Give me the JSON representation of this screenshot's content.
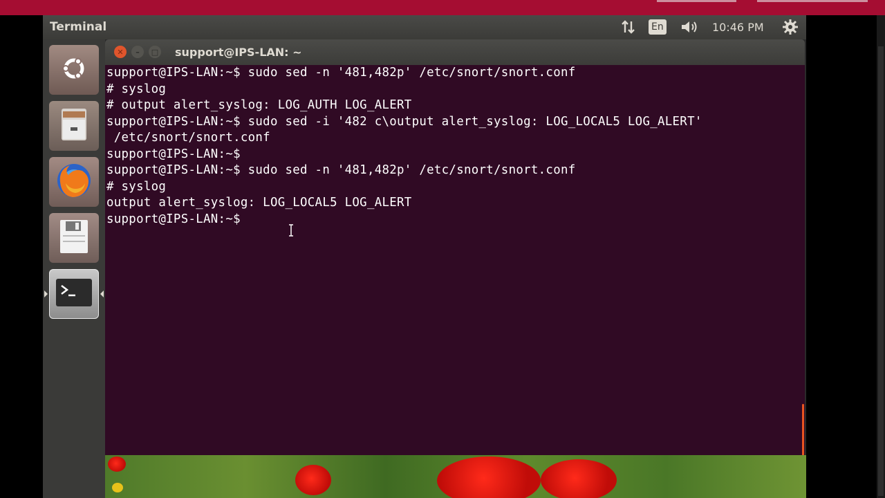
{
  "panel": {
    "app_title": "Terminal",
    "keyboard_layout": "En",
    "clock": "10:46 PM"
  },
  "window": {
    "title": "support@IPS-LAN: ~"
  },
  "terminal": {
    "lines": [
      "support@IPS-LAN:~$ sudo sed -n '481,482p' /etc/snort/snort.conf",
      "# syslog",
      "# output alert_syslog: LOG_AUTH LOG_ALERT",
      "support@IPS-LAN:~$ sudo sed -i '482 c\\output alert_syslog: LOG_LOCAL5 LOG_ALERT'",
      " /etc/snort/snort.conf",
      "support@IPS-LAN:~$",
      "support@IPS-LAN:~$ sudo sed -n '481,482p' /etc/snort/snort.conf",
      "# syslog",
      "output alert_syslog: LOG_LOCAL5 LOG_ALERT",
      "support@IPS-LAN:~$"
    ]
  },
  "launcher": {
    "items": [
      "dash-home",
      "files",
      "firefox",
      "save",
      "terminal"
    ]
  },
  "colors": {
    "terminal_bg": "#300a24",
    "accent": "#e95420",
    "host_strip": "#a50d32"
  }
}
